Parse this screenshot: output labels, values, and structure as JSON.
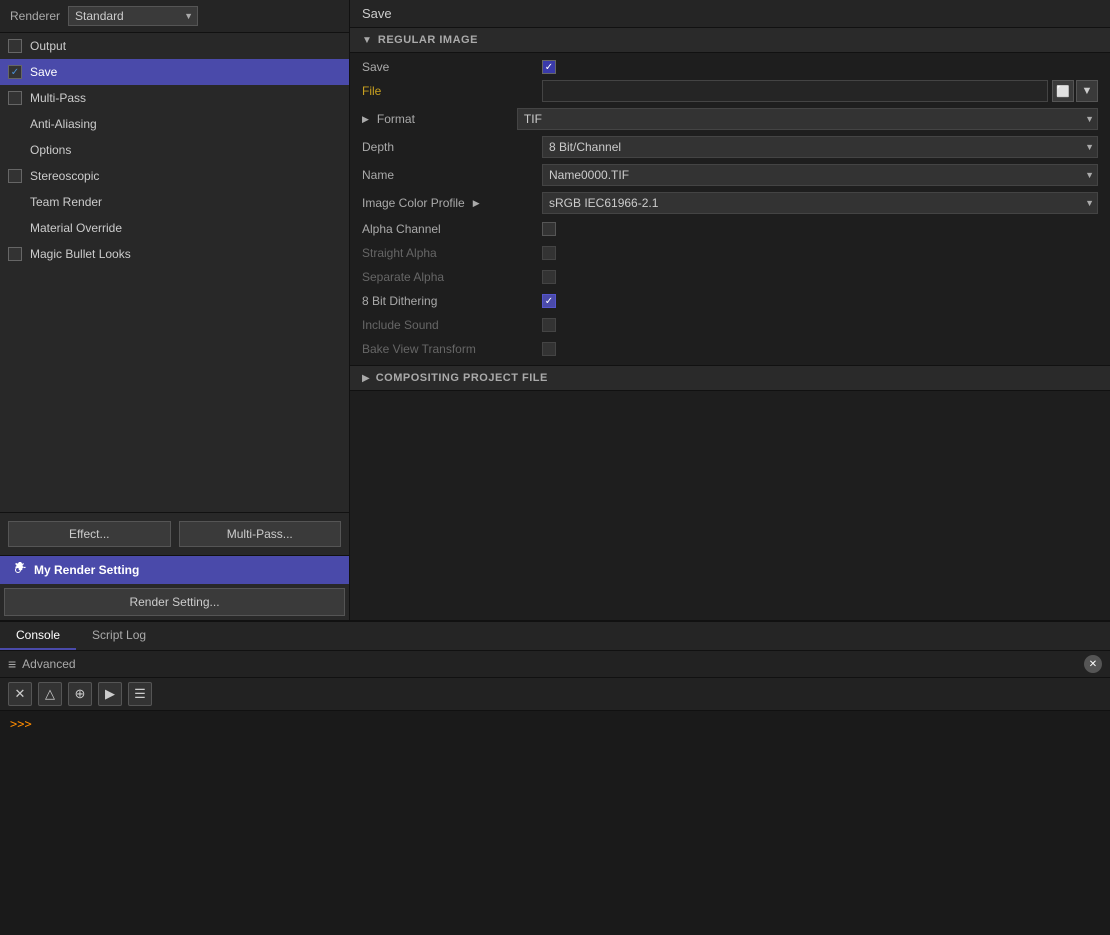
{
  "renderer": {
    "label": "Renderer",
    "value": "Standard"
  },
  "left_nav": {
    "items": [
      {
        "id": "output",
        "label": "Output",
        "checked": false,
        "active": false
      },
      {
        "id": "save",
        "label": "Save",
        "checked": true,
        "active": true
      },
      {
        "id": "multi-pass",
        "label": "Multi-Pass",
        "checked": false,
        "active": false
      },
      {
        "id": "anti-aliasing",
        "label": "Anti-Aliasing",
        "checked": false,
        "active": false,
        "no_checkbox": true
      },
      {
        "id": "options",
        "label": "Options",
        "checked": false,
        "active": false,
        "no_checkbox": true
      },
      {
        "id": "stereoscopic",
        "label": "Stereoscopic",
        "checked": false,
        "active": false
      },
      {
        "id": "team-render",
        "label": "Team Render",
        "checked": false,
        "active": false,
        "no_checkbox": true
      },
      {
        "id": "material-override",
        "label": "Material Override",
        "checked": false,
        "active": false,
        "no_checkbox": true
      },
      {
        "id": "magic-bullet-looks",
        "label": "Magic Bullet Looks",
        "checked": false,
        "active": false
      }
    ]
  },
  "buttons": {
    "effect": "Effect...",
    "multi_pass": "Multi-Pass...",
    "render_setting": "Render Setting..."
  },
  "my_render": {
    "label": "My Render Setting"
  },
  "right_panel": {
    "title": "Save",
    "regular_image": {
      "section_label": "REGULAR IMAGE",
      "save_label": "Save",
      "save_checked": true,
      "file_label": "File",
      "format_label": "Format",
      "format_value": "TIF",
      "depth_label": "Depth",
      "depth_value": "8 Bit/Channel",
      "name_label": "Name",
      "name_value": "Name0000.TIF",
      "image_color_profile_label": "Image Color Profile",
      "image_color_profile_value": "sRGB IEC61966-2.1",
      "alpha_channel_label": "Alpha Channel",
      "alpha_channel_checked": false,
      "straight_alpha_label": "Straight Alpha",
      "straight_alpha_checked": false,
      "separate_alpha_label": "Separate Alpha",
      "separate_alpha_checked": false,
      "bit_dithering_label": "8 Bit Dithering",
      "bit_dithering_checked": true,
      "include_sound_label": "Include Sound",
      "include_sound_checked": false,
      "bake_view_transform_label": "Bake View Transform",
      "bake_view_transform_checked": false
    },
    "compositing": {
      "section_label": "COMPOSITING PROJECT FILE"
    }
  },
  "console": {
    "tabs": [
      {
        "id": "console",
        "label": "Console",
        "active": true
      },
      {
        "id": "script-log",
        "label": "Script Log",
        "active": false
      }
    ],
    "title": "Advanced",
    "prompt": ">>>",
    "actions": [
      {
        "id": "clear",
        "icon": "✕",
        "label": "clear"
      },
      {
        "id": "script",
        "icon": "△",
        "label": "script"
      },
      {
        "id": "node",
        "icon": "⊕",
        "label": "node"
      },
      {
        "id": "run",
        "icon": "▶",
        "label": "run"
      },
      {
        "id": "doc",
        "icon": "☰",
        "label": "doc"
      }
    ]
  }
}
